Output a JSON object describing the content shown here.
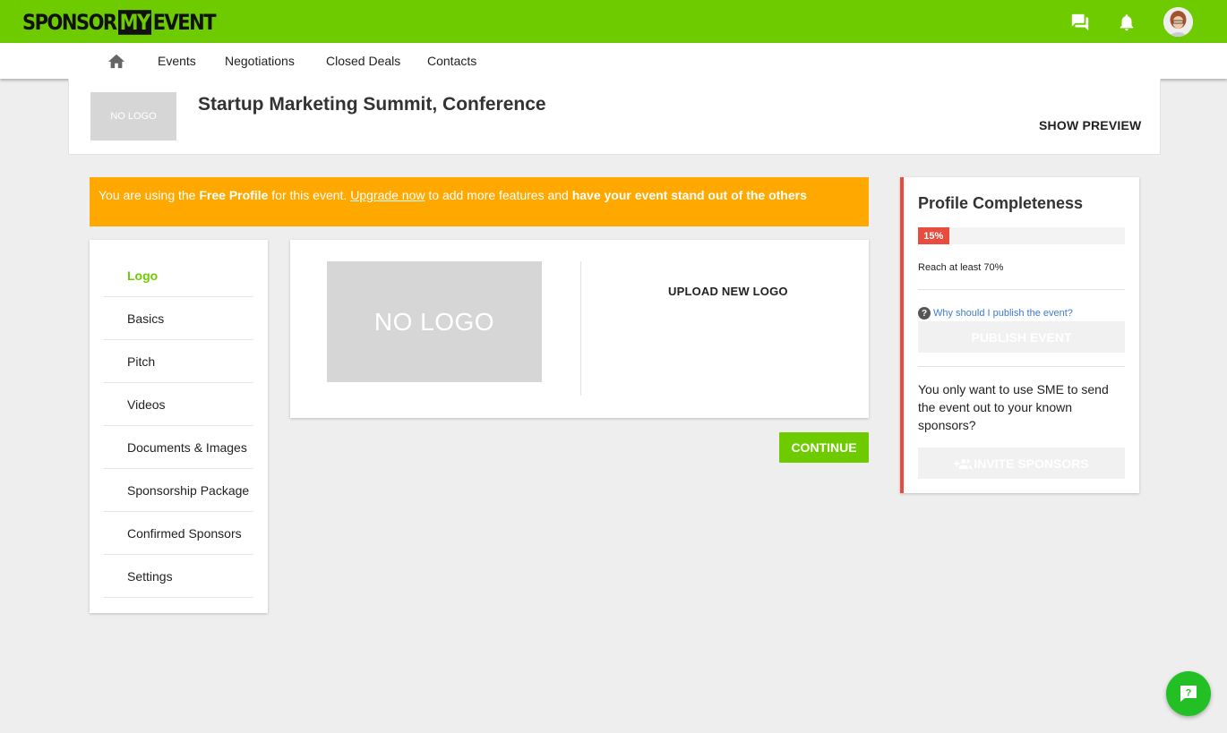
{
  "brand": {
    "part1": "SPONSOR",
    "part2": "MY",
    "part3": "EVENT"
  },
  "topbar": {
    "icons": [
      "chat-icon",
      "bell-icon",
      "avatar"
    ]
  },
  "nav": {
    "links": [
      "Events",
      "Negotiations",
      "Closed Deals",
      "Contacts"
    ]
  },
  "header": {
    "logo_placeholder": "NO LOGO",
    "title": "Startup Marketing Summit, Conference",
    "preview_label": "SHOW PREVIEW"
  },
  "banner": {
    "t1": "You are using the ",
    "b1": "Free Profile",
    "t2": " for this event. ",
    "link": "Upgrade now",
    "t3": " to add more features and ",
    "b2": "have your event stand out of the others"
  },
  "sidebar": {
    "items": [
      "Logo",
      "Basics",
      "Pitch",
      "Videos",
      "Documents & Images",
      "Sponsorship Package",
      "Confirmed Sponsors",
      "Settings"
    ],
    "active": "Logo"
  },
  "logo_panel": {
    "placeholder": "NO LOGO",
    "upload_label": "UPLOAD NEW LOGO"
  },
  "continue_label": "CONTINUE",
  "completeness": {
    "title": "Profile Completeness",
    "percent_label": "15%",
    "percent": 15,
    "reach": "Reach at least 70%",
    "why": "Why should I publish the event?",
    "publish_label": "PUBLISH EVENT",
    "text": "You only want to use SME to send the event out to your known sponsors?",
    "invite_label": "INVITE SPONSORS"
  },
  "colors": {
    "brand_green": "#6dcb00",
    "banner": "#ffa800",
    "alert_red": "#e74c3c",
    "help_green": "#22c025"
  }
}
